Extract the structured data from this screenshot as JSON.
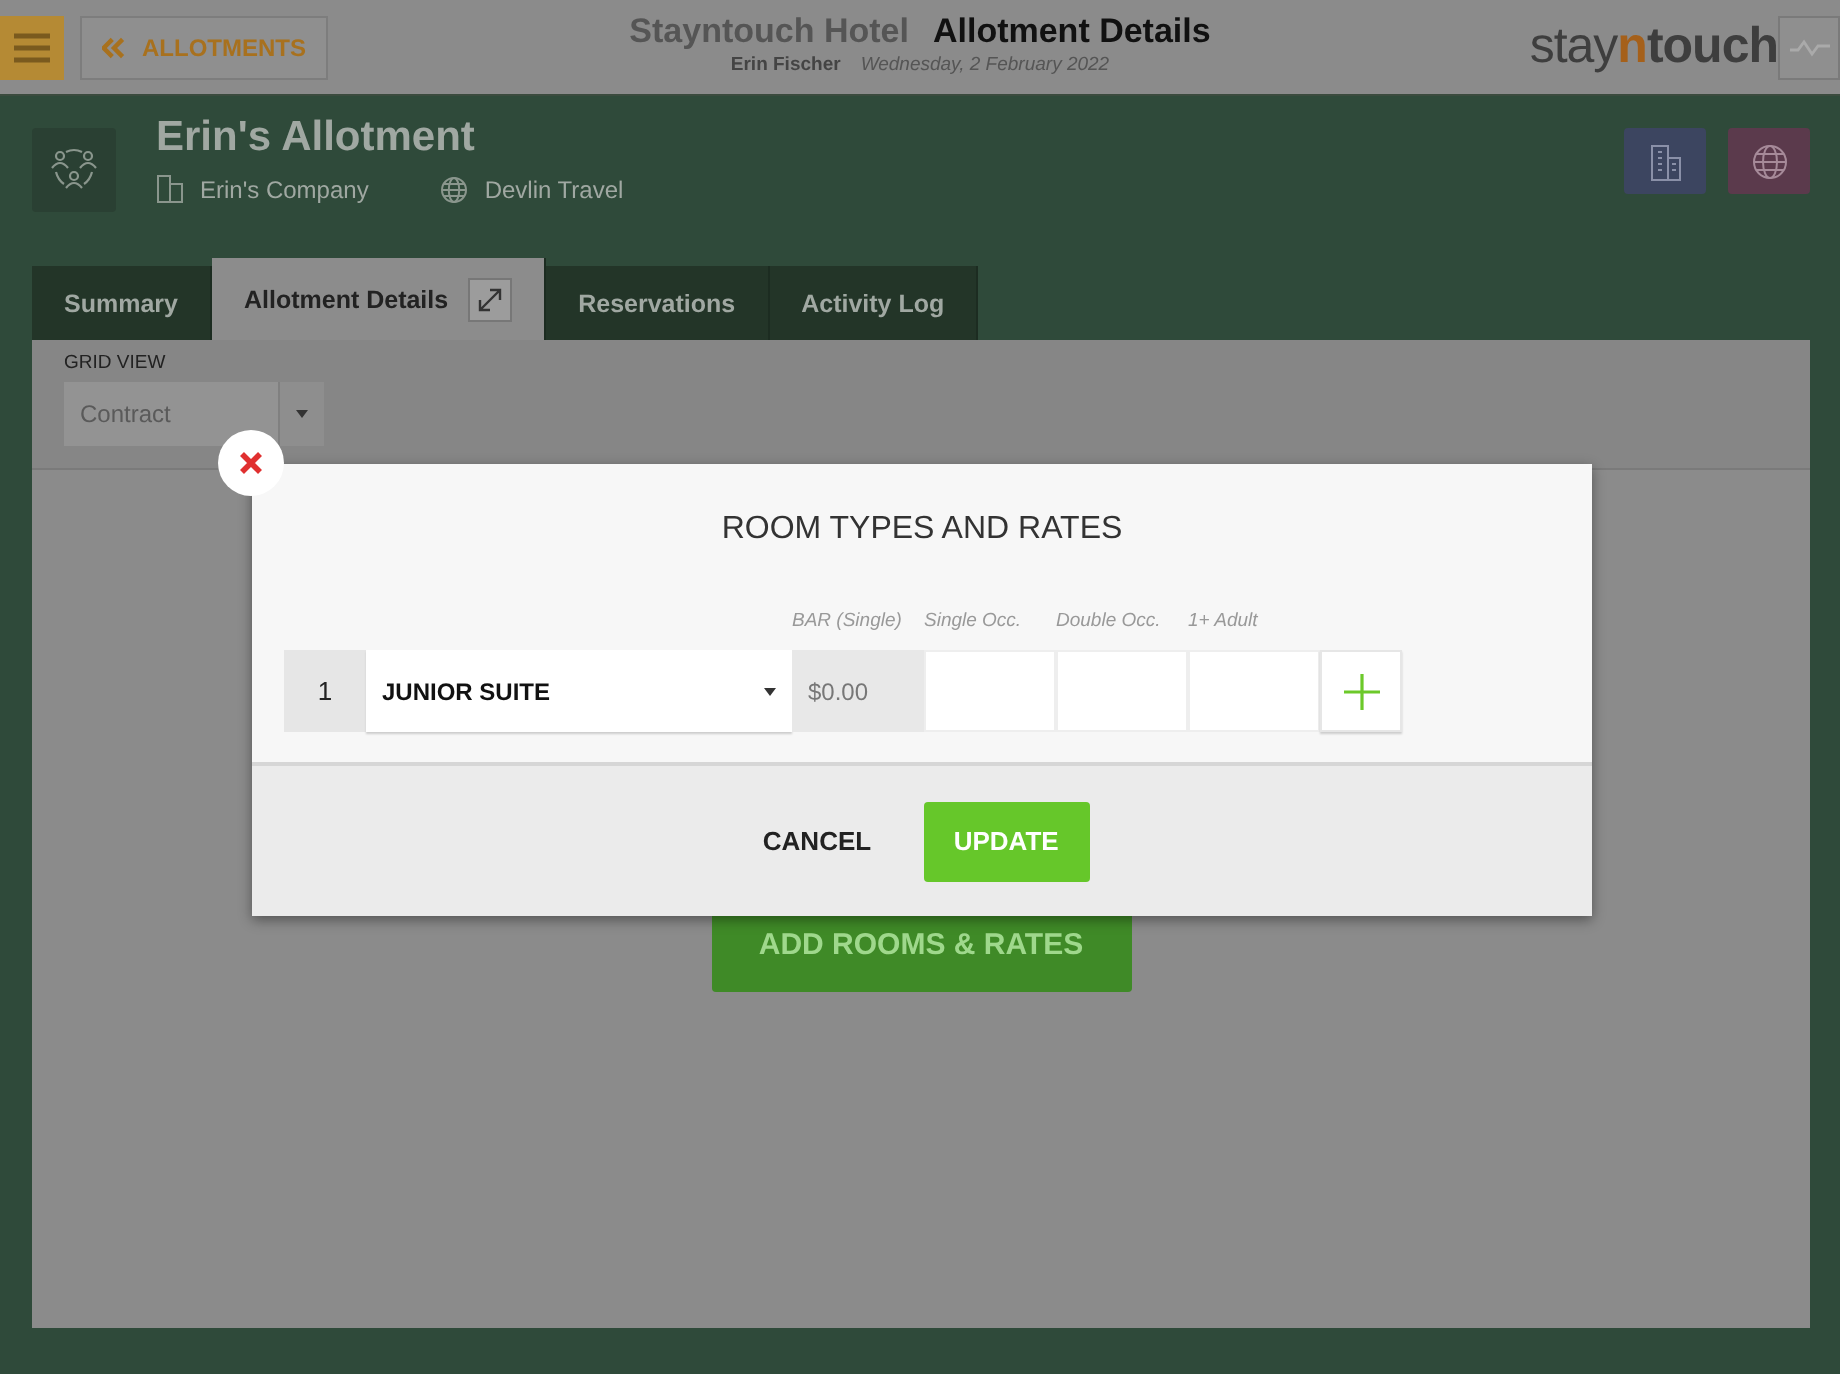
{
  "header": {
    "back_button": {
      "label": "ALLOTMENTS"
    },
    "hotel": "Stayntouch Hotel",
    "page_title": "Allotment Details",
    "user": "Erin Fischer",
    "date": "Wednesday, 2 February 2022",
    "logo": [
      "stay",
      "n",
      "touch"
    ]
  },
  "allotment": {
    "name": "Erin's Allotment",
    "company": "Erin's Company",
    "travel_agent": "Devlin Travel"
  },
  "tabs": [
    {
      "label": "Summary",
      "selected": false
    },
    {
      "label": "Allotment Details",
      "selected": true
    },
    {
      "label": "Reservations",
      "selected": false
    },
    {
      "label": "Activity Log",
      "selected": false
    }
  ],
  "grid_view": {
    "label": "GRID VIEW",
    "value": "Contract"
  },
  "add_button": {
    "label": "ADD ROOMS & RATES"
  },
  "modal": {
    "title": "ROOM TYPES AND RATES",
    "columns": [
      "BAR (Single)",
      "Single Occ.",
      "Double Occ.",
      "1+ Adult"
    ],
    "row": {
      "number": "1",
      "room_type": "JUNIOR SUITE",
      "bar_rate": "$0.00"
    },
    "buttons": {
      "cancel": "CANCEL",
      "update": "UPDATE"
    }
  }
}
